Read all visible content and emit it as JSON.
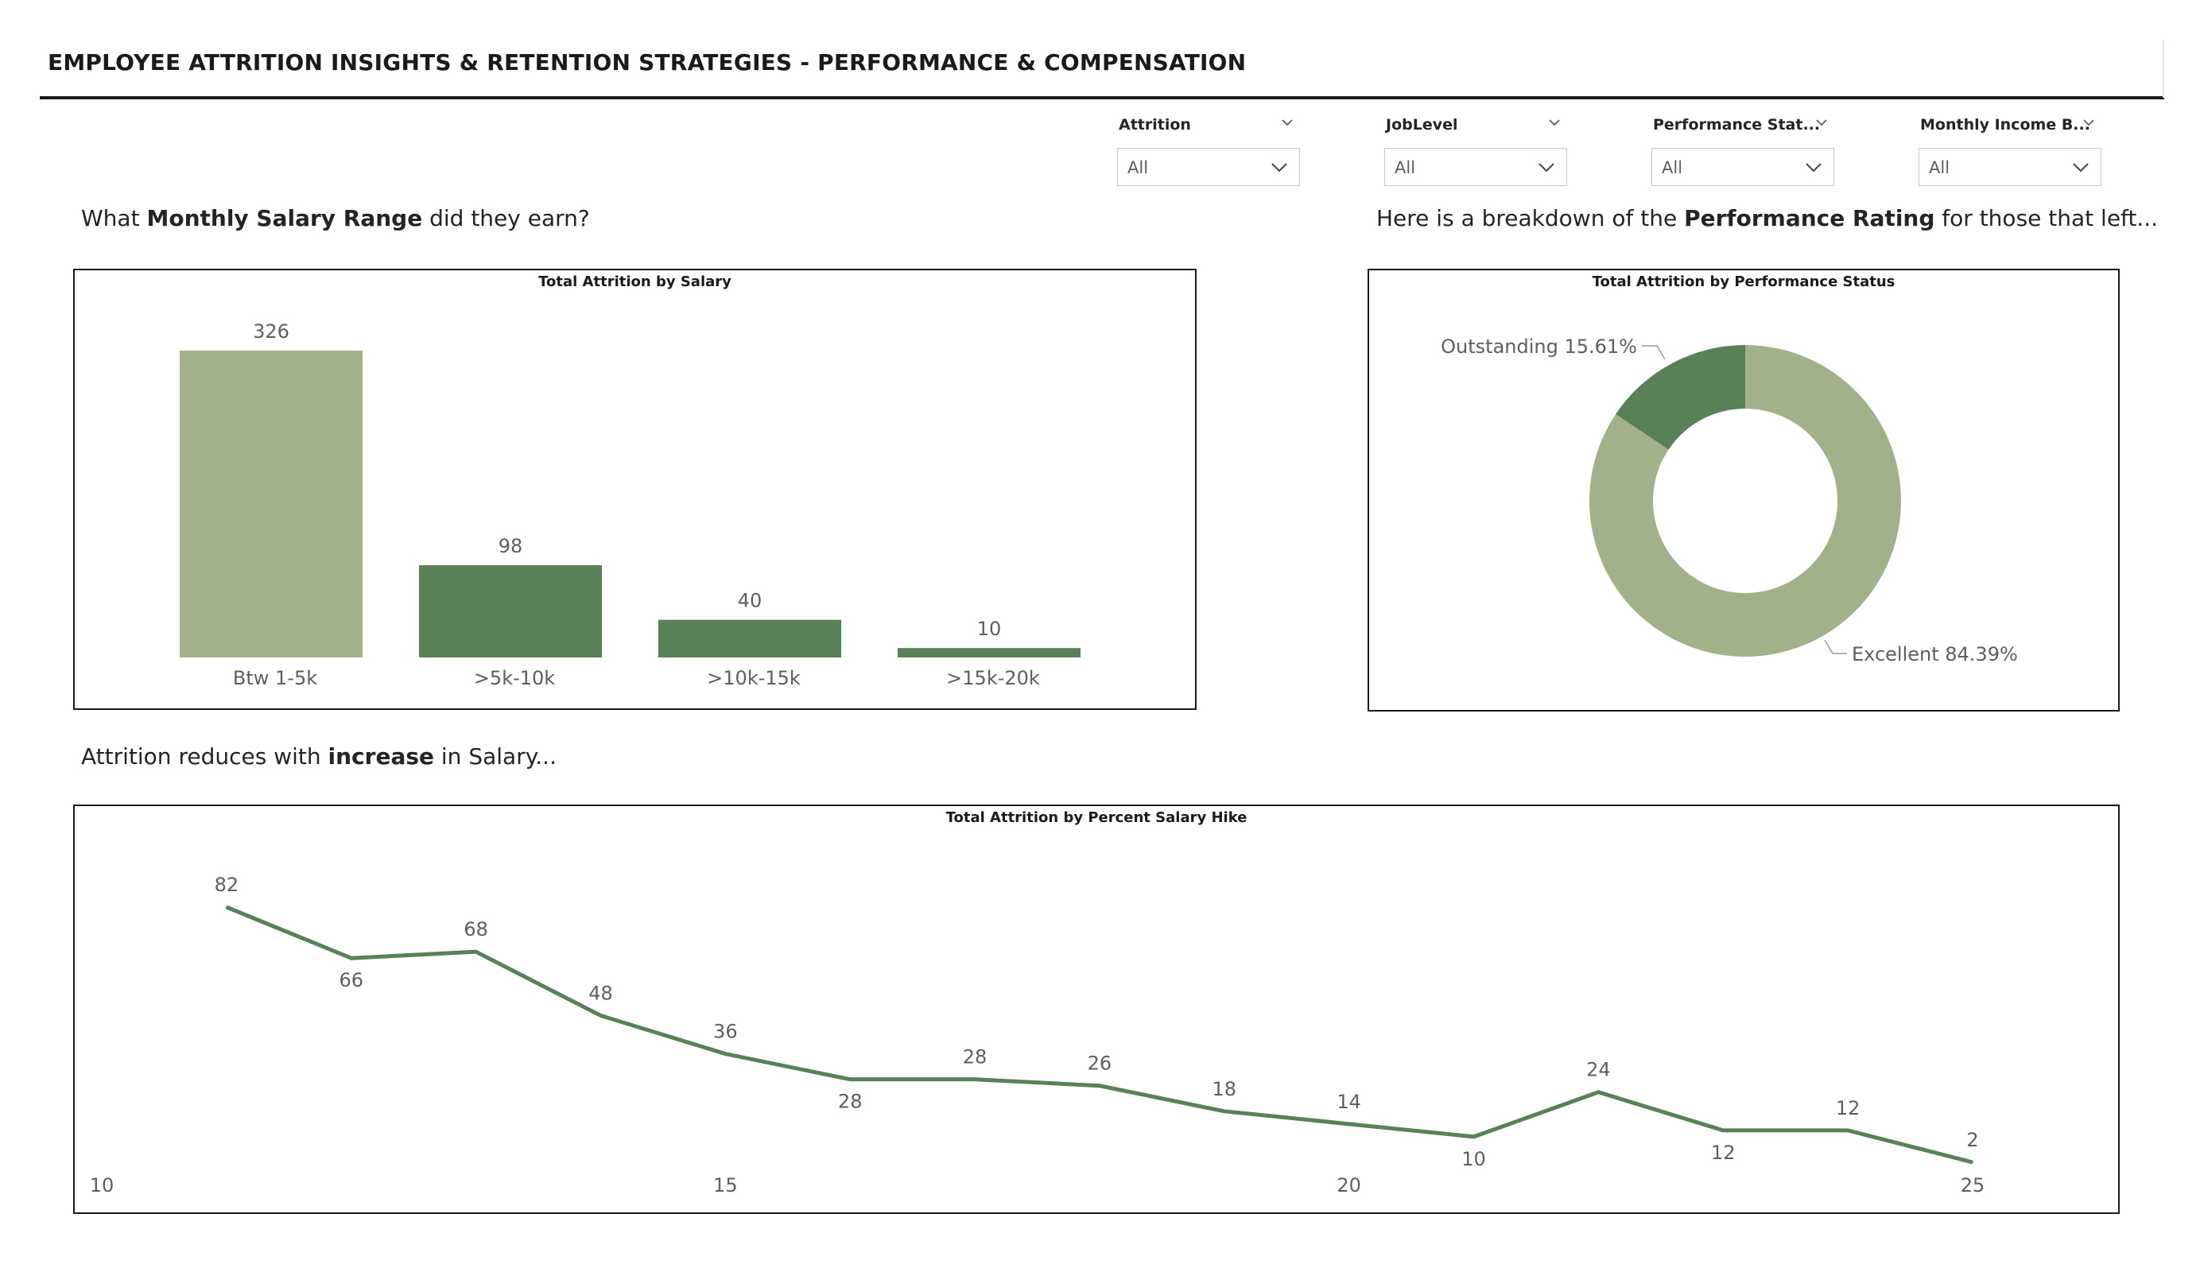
{
  "header": {
    "title": "EMPLOYEE ATTRITION INSIGHTS & RETENTION STRATEGIES - PERFORMANCE & COMPENSATION"
  },
  "slicers": [
    {
      "label": "Attrition",
      "value": "All"
    },
    {
      "label": "JobLevel",
      "value": "All"
    },
    {
      "label": "Performance Stat...",
      "value": "All"
    },
    {
      "label": "Monthly Income B...",
      "value": "All"
    }
  ],
  "sections": {
    "salary_question": {
      "pre": "What ",
      "bold": "Monthly Salary Range",
      "post": " did they earn?"
    },
    "performance_question": {
      "pre": "Here is a breakdown of the ",
      "bold": "Performance Rating",
      "post": " for those that left..."
    },
    "hike_question": {
      "pre": "Attrition reduces with ",
      "bold": "increase",
      "post": " in Salary..."
    }
  },
  "colors": {
    "light_green": "#a3b18a",
    "dark_green": "#588157",
    "text": "#252423",
    "label": "#605e5c"
  },
  "chart_data": [
    {
      "type": "bar",
      "title": "Total Attrition by Salary",
      "categories": [
        "Btw 1-5k",
        ">5k-10k",
        ">10k-15k",
        ">15k-20k"
      ],
      "values": [
        326,
        98,
        40,
        10
      ],
      "data_labels": [
        "326",
        "98",
        "40",
        "10"
      ],
      "bar_colors": [
        "#a3b18a",
        "#588157",
        "#588157",
        "#588157"
      ],
      "ylim": [
        0,
        326
      ],
      "grid": false
    },
    {
      "type": "pie",
      "subtype": "donut",
      "title": "Total Attrition by Performance Status",
      "slices": [
        {
          "label": "Outstanding",
          "percent": 15.61,
          "display": "Outstanding 15.61%",
          "color": "#588157"
        },
        {
          "label": "Excellent",
          "percent": 84.39,
          "display": "Excellent 84.39%",
          "color": "#a3b18a"
        }
      ]
    },
    {
      "type": "line",
      "title": "Total Attrition by Percent Salary Hike",
      "x": [
        11,
        12,
        13,
        14,
        15,
        16,
        17,
        18,
        19,
        20,
        21,
        22,
        23,
        24,
        25
      ],
      "values": [
        82,
        66,
        68,
        48,
        36,
        28,
        28,
        26,
        18,
        14,
        10,
        24,
        12,
        12,
        2
      ],
      "data_labels": [
        "82",
        "66",
        "68",
        "48",
        "36",
        "28",
        "28",
        "26",
        "18",
        "14",
        "10",
        "24",
        "12",
        "12",
        "2"
      ],
      "x_ticks": [
        "10",
        "15",
        "20",
        "25"
      ],
      "x_tick_values": [
        10,
        15,
        20,
        25
      ],
      "xlim": [
        10,
        25
      ],
      "line_color": "#588157",
      "grid": false
    }
  ]
}
